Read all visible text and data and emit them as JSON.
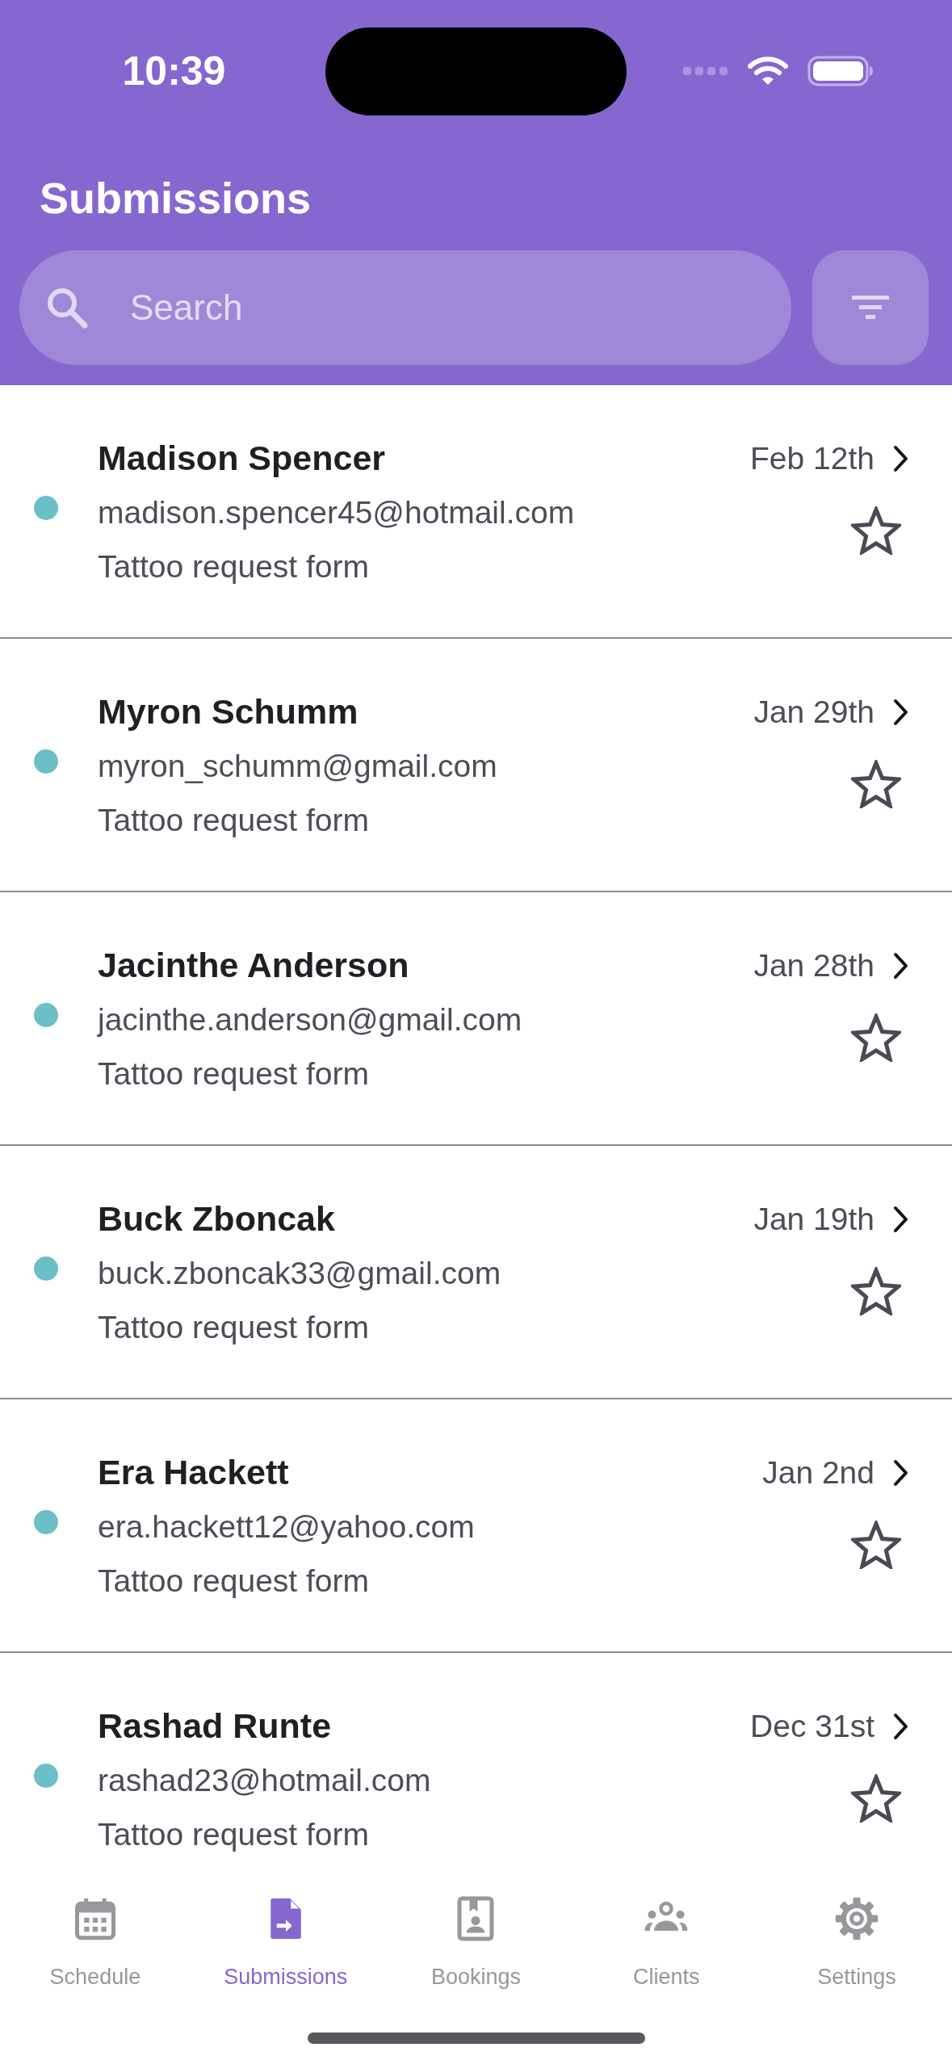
{
  "status_bar": {
    "time": "10:39"
  },
  "header": {
    "title": "Submissions",
    "search": {
      "placeholder": "Search"
    }
  },
  "submissions": [
    {
      "name": "Madison Spencer",
      "email": "madison.spencer45@hotmail.com",
      "form": "Tattoo request form",
      "date": "Feb 12th",
      "unread": true,
      "starred": false
    },
    {
      "name": "Myron Schumm",
      "email": "myron_schumm@gmail.com",
      "form": "Tattoo request form",
      "date": "Jan 29th",
      "unread": true,
      "starred": false
    },
    {
      "name": "Jacinthe Anderson",
      "email": "jacinthe.anderson@gmail.com",
      "form": "Tattoo request form",
      "date": "Jan 28th",
      "unread": true,
      "starred": false
    },
    {
      "name": "Buck Zboncak",
      "email": "buck.zboncak33@gmail.com",
      "form": "Tattoo request form",
      "date": "Jan 19th",
      "unread": true,
      "starred": false
    },
    {
      "name": "Era Hackett",
      "email": "era.hackett12@yahoo.com",
      "form": "Tattoo request form",
      "date": "Jan 2nd",
      "unread": true,
      "starred": false
    },
    {
      "name": "Rashad Runte",
      "email": "rashad23@hotmail.com",
      "form": "Tattoo request form",
      "date": "Dec 31st",
      "unread": true,
      "starred": false
    }
  ],
  "tab_bar": [
    {
      "label": "Schedule",
      "selected": false
    },
    {
      "label": "Submissions",
      "selected": true
    },
    {
      "label": "Bookings",
      "selected": false
    },
    {
      "label": "Clients",
      "selected": false
    },
    {
      "label": "Settings",
      "selected": false
    }
  ]
}
